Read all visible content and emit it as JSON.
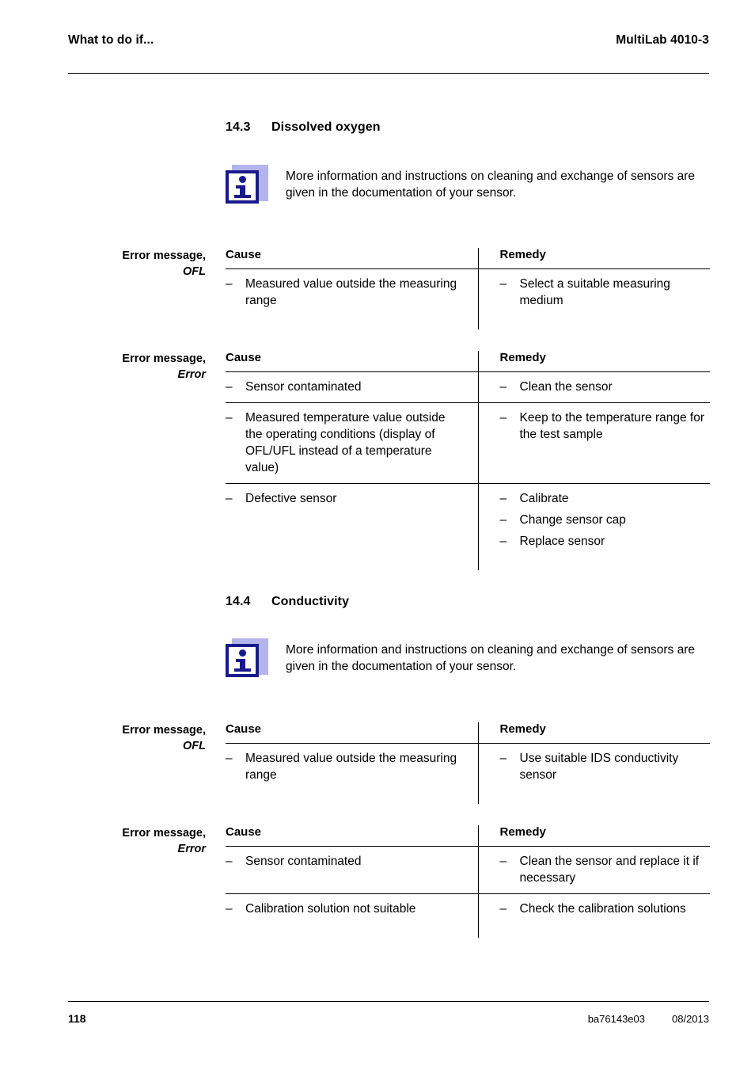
{
  "header": {
    "left": "What to do if...",
    "right": "MultiLab 4010-3"
  },
  "footer": {
    "page_number": "118",
    "doc_code": "ba76143e03",
    "date": "08/2013"
  },
  "sections": [
    {
      "number": "14.3",
      "title": "Dissolved oxygen",
      "note": "More information and instructions on cleaning and exchange of sensors are given in the documentation of your sensor.",
      "tables": [
        {
          "margin_label": "Error message,",
          "margin_code": "OFL",
          "headers": {
            "cause": "Cause",
            "remedy": "Remedy"
          },
          "rows": [
            {
              "cause": [
                "Measured value outside the measuring range"
              ],
              "remedy": [
                "Select a suitable measuring medium"
              ]
            }
          ]
        },
        {
          "margin_label": "Error message,",
          "margin_code": "Error",
          "headers": {
            "cause": "Cause",
            "remedy": "Remedy"
          },
          "rows": [
            {
              "cause": [
                "Sensor contaminated"
              ],
              "remedy": [
                "Clean the sensor"
              ]
            },
            {
              "cause": [
                "Measured temperature value outside the operating conditions (display of OFL/UFL instead of a temperature value)"
              ],
              "remedy": [
                "Keep to the temperature range for the test sample"
              ]
            },
            {
              "cause": [
                "Defective sensor"
              ],
              "remedy": [
                "Calibrate",
                "Change sensor cap",
                "Replace sensor"
              ]
            }
          ]
        }
      ]
    },
    {
      "number": "14.4",
      "title": "Conductivity",
      "note": "More information and instructions on cleaning and exchange of sensors are given in the documentation of your sensor.",
      "tables": [
        {
          "margin_label": "Error message,",
          "margin_code": "OFL",
          "headers": {
            "cause": "Cause",
            "remedy": "Remedy"
          },
          "rows": [
            {
              "cause": [
                "Measured value outside the measuring range"
              ],
              "remedy": [
                "Use suitable IDS conductivity sensor"
              ]
            }
          ]
        },
        {
          "margin_label": "Error message,",
          "margin_code": "Error",
          "headers": {
            "cause": "Cause",
            "remedy": "Remedy"
          },
          "rows": [
            {
              "cause": [
                "Sensor contaminated"
              ],
              "remedy": [
                "Clean the sensor and replace it if necessary"
              ]
            },
            {
              "cause": [
                "Calibration solution not suitable"
              ],
              "remedy": [
                "Check the calibration solutions"
              ]
            }
          ]
        }
      ]
    }
  ],
  "icons": {
    "info": "info-icon"
  },
  "colors": {
    "info_icon_navy": "#1a1a8c",
    "info_icon_shadow": "#b4b4ec",
    "rule": "#000000",
    "text": "#000000"
  },
  "bullet": "–"
}
